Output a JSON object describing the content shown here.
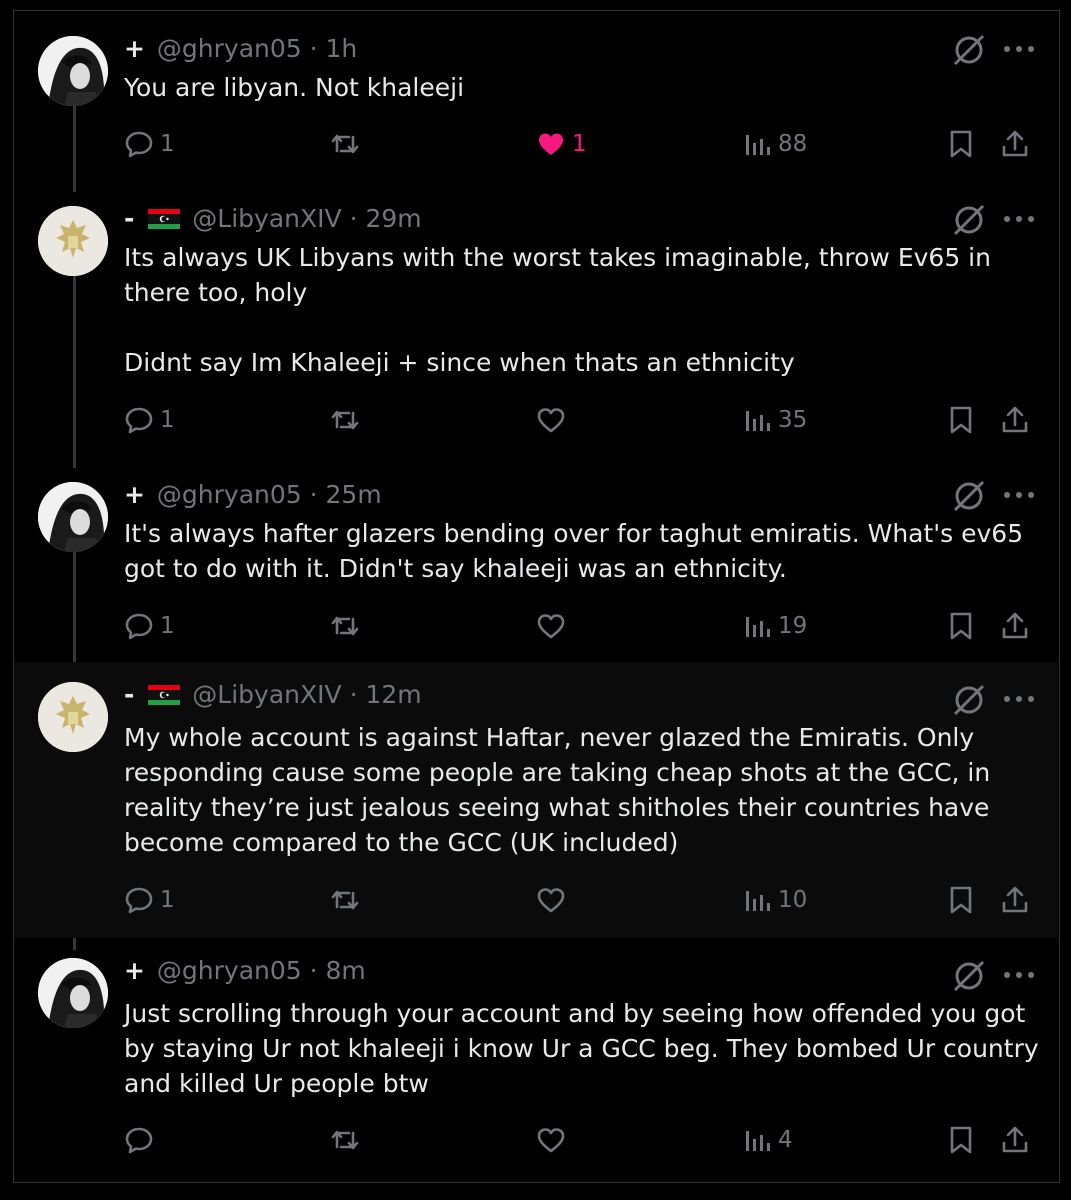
{
  "tweets": [
    {
      "prefix": "+",
      "handle": "@ghryan05",
      "dot": "·",
      "time": "1h",
      "has_flag": false,
      "text": "You are libyan. Not khaleeji",
      "reply_count": "1",
      "retweet_count": "",
      "like_count": "1",
      "liked": true,
      "view_count": "88",
      "avatar": "dark-profile-photo"
    },
    {
      "prefix": "-",
      "handle": "@LibyanXIV",
      "dot": "·",
      "time": "29m",
      "has_flag": true,
      "text": "Its always UK Libyans with the worst takes imaginable, throw Ev65 in there too, holy\n\nDidnt say Im Khaleeji + since when thats an ethnicity",
      "reply_count": "1",
      "retweet_count": "",
      "like_count": "",
      "liked": false,
      "view_count": "35",
      "avatar": "eagle-emblem"
    },
    {
      "prefix": "+",
      "handle": "@ghryan05",
      "dot": "·",
      "time": "25m",
      "has_flag": false,
      "text": "It's always hafter glazers bending over for taghut emiratis. What's ev65 got to do with it. Didn't say khaleeji was an ethnicity.",
      "reply_count": "1",
      "retweet_count": "",
      "like_count": "",
      "liked": false,
      "view_count": "19",
      "avatar": "dark-profile-photo"
    },
    {
      "prefix": "-",
      "handle": "@LibyanXIV",
      "dot": "·",
      "time": "12m",
      "has_flag": true,
      "text": "My whole account is against Haftar, never glazed the Emiratis. Only responding cause some people are taking cheap shots at the GCC, in reality they’re just jealous seeing what shitholes their countries have become compared to the GCC (UK included)",
      "reply_count": "1",
      "retweet_count": "",
      "like_count": "",
      "liked": false,
      "view_count": "10",
      "avatar": "eagle-emblem"
    },
    {
      "prefix": "+",
      "handle": "@ghryan05",
      "dot": "·",
      "time": "8m",
      "has_flag": false,
      "text": "Just scrolling through your account and by seeing how offended you got  by staying Ur not khaleeji i know Ur a GCC beg. They bombed Ur country and killed Ur people btw",
      "reply_count": "",
      "retweet_count": "",
      "like_count": "",
      "liked": false,
      "view_count": "4",
      "avatar": "dark-profile-photo"
    }
  ],
  "colors": {
    "background": "#000000",
    "highlight_background": "#0b0b0b",
    "text": "#e7e9ea",
    "muted": "#71767b",
    "like": "#f91880",
    "border": "#2f3336"
  },
  "icons": [
    "reply-icon",
    "retweet-icon",
    "like-icon",
    "views-icon",
    "bookmark-icon",
    "share-icon",
    "grok-icon",
    "more-icon"
  ]
}
